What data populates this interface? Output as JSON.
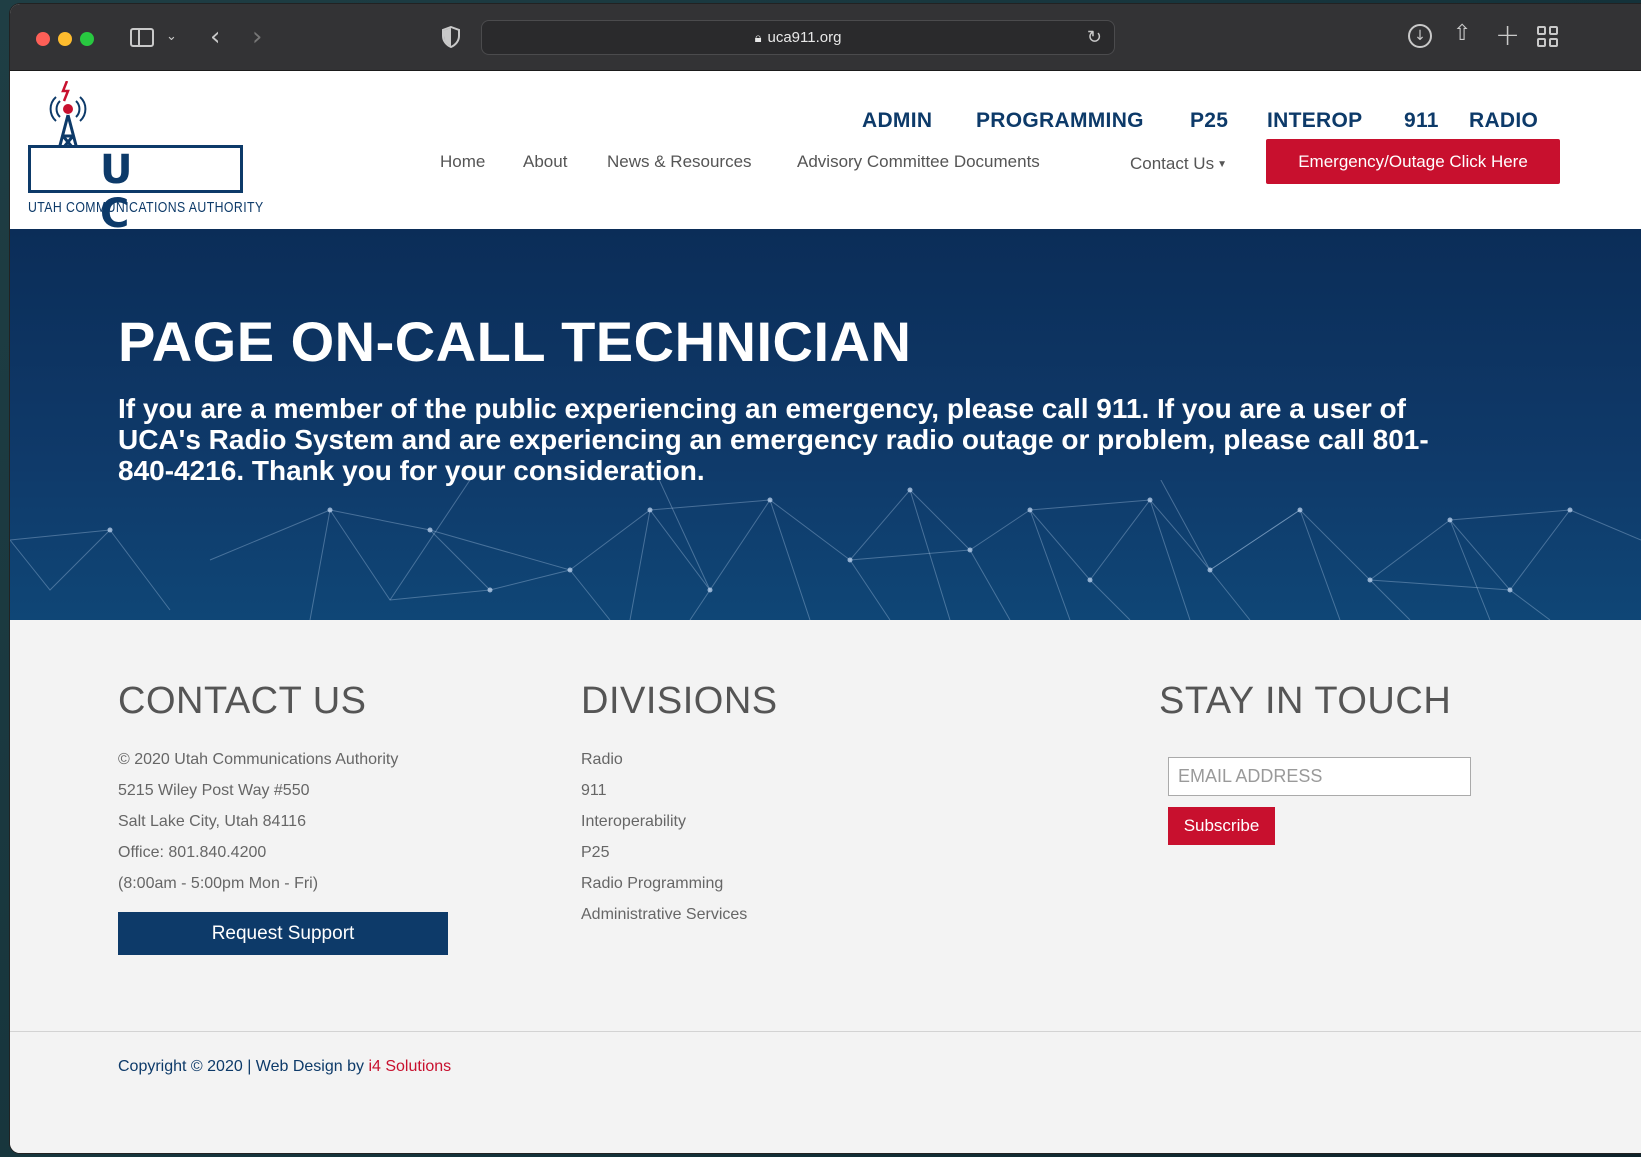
{
  "browser": {
    "url": "uca911.org"
  },
  "logo": {
    "letters": "U C A",
    "tagline": "UTAH COMMUNICATIONS AUTHORITY"
  },
  "nav_top": [
    "ADMIN",
    "PROGRAMMING",
    "P25",
    "INTEROP",
    "911",
    "RADIO"
  ],
  "nav_main": {
    "home": "Home",
    "about": "About",
    "news": "News & Resources",
    "advisory": "Advisory Committee Documents",
    "contact": "Contact Us",
    "emergency": "Emergency/Outage Click Here"
  },
  "hero": {
    "title": "PAGE ON-CALL TECHNICIAN",
    "text": "If you are a member of the public experiencing an emergency, please call 911.  If you are a user of UCA's Radio System and are experiencing an emergency radio outage or problem, please call 801-840-4216.  Thank you for your consideration."
  },
  "contact": {
    "title": "CONTACT US",
    "lines": [
      "© 2020 Utah Communications Authority",
      "5215 Wiley Post Way #550",
      "Salt Lake City, Utah 84116",
      "Office: 801.840.4200",
      "(8:00am - 5:00pm Mon - Fri)"
    ],
    "button": "Request Support"
  },
  "divisions": {
    "title": "DIVISIONS",
    "items": [
      "Radio",
      "911",
      "Interoperability",
      "P25",
      "Radio Programming",
      "Administrative Services"
    ]
  },
  "stay": {
    "title": "STAY IN TOUCH",
    "placeholder": "EMAIL ADDRESS",
    "button": "Subscribe"
  },
  "footer": {
    "copyright_prefix": "Copyright © 2020 | Web Design by ",
    "link": "i4 Solutions"
  },
  "colors": {
    "brand_navy": "#0d3a69",
    "accent_red": "#c8102e"
  }
}
